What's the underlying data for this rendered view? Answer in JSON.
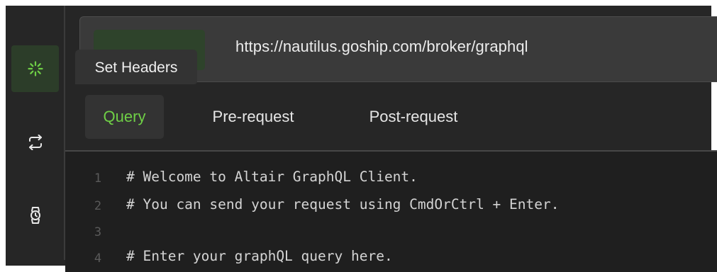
{
  "sidebar": {
    "items": [
      {
        "name": "loading-spinner",
        "active": true
      },
      {
        "name": "swap-arrows",
        "active": false
      },
      {
        "name": "watch",
        "active": false
      }
    ]
  },
  "request": {
    "url": "https://nautilus.goship.com/broker/graphql",
    "tooltip": "Set Headers"
  },
  "tabs": [
    {
      "label": "Query",
      "active": true
    },
    {
      "label": "Pre-request",
      "active": false
    },
    {
      "label": "Post-request",
      "active": false
    }
  ],
  "editor": {
    "lines": [
      {
        "num": "1",
        "text": "# Welcome to Altair GraphQL Client."
      },
      {
        "num": "2",
        "text": "# You can send your request using CmdOrCtrl + Enter."
      },
      {
        "num": "3",
        "text": ""
      },
      {
        "num": "4",
        "text": "# Enter your graphQL query here."
      }
    ]
  },
  "colors": {
    "background": "#262626",
    "editor_background": "#1f1f1f",
    "accent": "#6fcf46",
    "active_rail": "#2c3d29"
  }
}
